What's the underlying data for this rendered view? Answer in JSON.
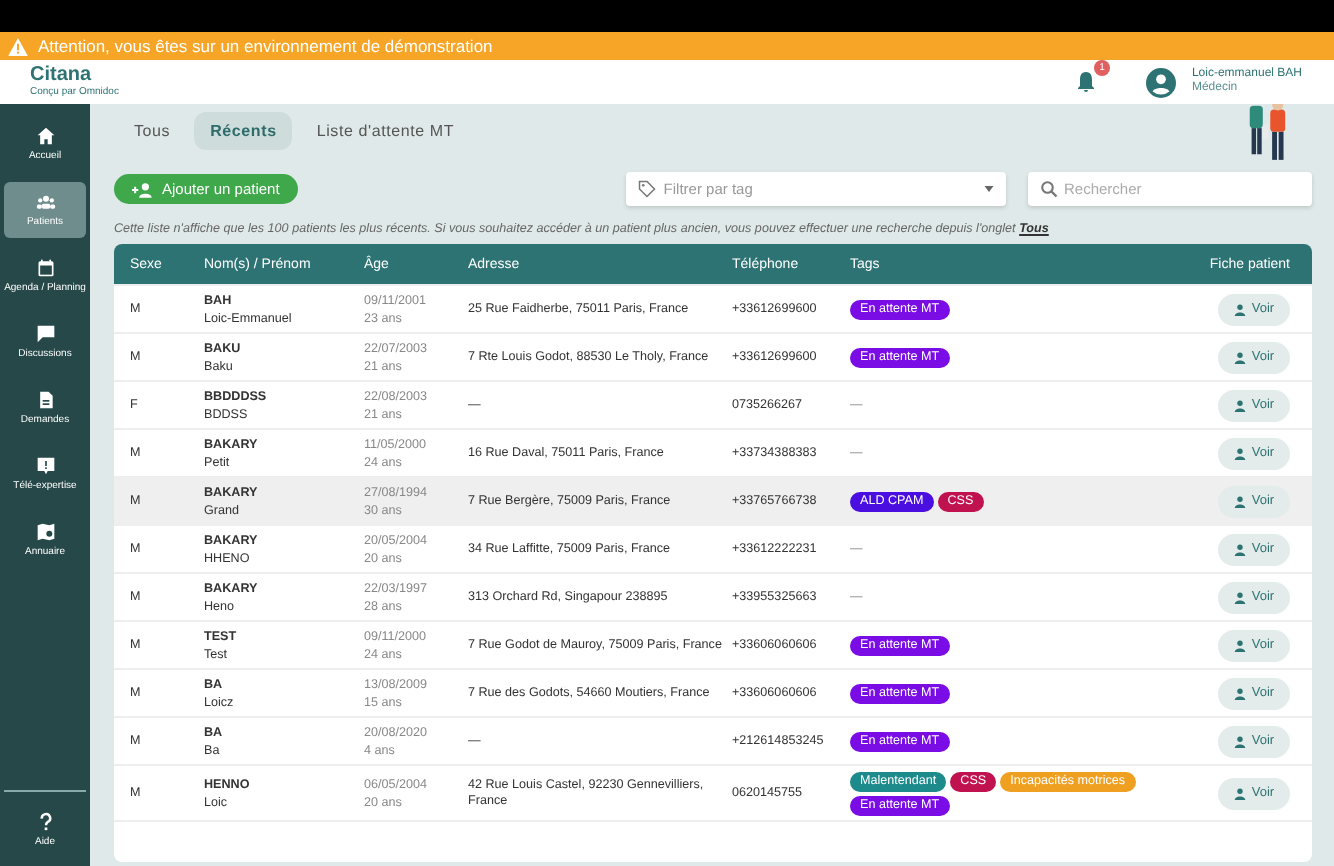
{
  "banner": {
    "text": "Attention, vous êtes sur un environnement de démonstration"
  },
  "header": {
    "logo": "Citana",
    "logo_sub": "Conçu par Omnidoc",
    "notifications": "1",
    "user_name": "Loic-emmanuel BAH",
    "user_role": "Médecin"
  },
  "sidebar": {
    "items": [
      {
        "label": "Accueil",
        "selected": false
      },
      {
        "label": "Patients",
        "selected": true
      },
      {
        "label": "Agenda / Planning",
        "selected": false
      },
      {
        "label": "Discussions",
        "selected": false
      },
      {
        "label": "Demandes",
        "selected": false
      },
      {
        "label": "Télé-expertise",
        "selected": false
      },
      {
        "label": "Annuaire",
        "selected": false
      }
    ],
    "bottom": {
      "label": "Aide"
    }
  },
  "tabs": [
    {
      "label": "Tous",
      "selected": false
    },
    {
      "label": "Récents",
      "selected": true
    },
    {
      "label": "Liste d'attente MT",
      "selected": false
    }
  ],
  "add_button": "Ajouter un patient",
  "tag_filter": {
    "placeholder": "Filtrer par tag"
  },
  "search": {
    "placeholder": "Rechercher"
  },
  "note": {
    "text": "Cette liste n'affiche que les 100 patients les plus récents. Si vous souhaitez accéder à un patient plus ancien, vous pouvez effectuer une recherche depuis l'onglet",
    "link": "Tous"
  },
  "table": {
    "columns": [
      "Sexe",
      "Nom(s) / Prénom",
      "Âge",
      "Adresse",
      "Téléphone",
      "Tags",
      "Fiche patient"
    ],
    "rows": [
      {
        "sex": "M",
        "last": "BAH",
        "first": "Loic-Emmanuel",
        "dob": "09/11/2001",
        "age": "23 ans",
        "address": "25 Rue Faidherbe, 75011 Paris, France",
        "phone": "+33612699600",
        "tags": [
          {
            "label": "En attente MT",
            "color": "#7a0ce6"
          }
        ],
        "action": "Voir",
        "highlighted": false
      },
      {
        "sex": "M",
        "last": "BAKU",
        "first": "Baku",
        "dob": "22/07/2003",
        "age": "21 ans",
        "address": "7 Rte Louis Godot, 88530 Le Tholy, France",
        "phone": "+33612699600",
        "tags": [
          {
            "label": "En attente MT",
            "color": "#7a0ce6"
          }
        ],
        "action": "Voir",
        "highlighted": false
      },
      {
        "sex": "F",
        "last": "BBDDDSS",
        "first": "BDDSS",
        "dob": "22/08/2003",
        "age": "21 ans",
        "address": "—",
        "phone": "0735266267",
        "tags": [],
        "empty_tags": "—",
        "action": "Voir",
        "highlighted": false
      },
      {
        "sex": "M",
        "last": "BAKARY",
        "first": "Petit",
        "dob": "11/05/2000",
        "age": "24 ans",
        "address": "16 Rue Daval, 75011 Paris, France",
        "phone": "+33734388383",
        "tags": [],
        "empty_tags": "—",
        "action": "Voir",
        "highlighted": false
      },
      {
        "sex": "M",
        "last": "BAKARY",
        "first": "Grand",
        "dob": "27/08/1994",
        "age": "30 ans",
        "address": "7 Rue Bergère, 75009 Paris, France",
        "phone": "+33765766738",
        "tags": [
          {
            "label": "ALD CPAM",
            "color": "#4a0fe0"
          },
          {
            "label": "CSS",
            "color": "#c0124f"
          }
        ],
        "action": "Voir",
        "highlighted": true
      },
      {
        "sex": "M",
        "last": "BAKARY",
        "first": "HHENO",
        "dob": "20/05/2004",
        "age": "20 ans",
        "address": "34 Rue Laffitte, 75009 Paris, France",
        "phone": "+33612222231",
        "tags": [],
        "empty_tags": "—",
        "action": "Voir",
        "highlighted": false
      },
      {
        "sex": "M",
        "last": "BAKARY",
        "first": "Heno",
        "dob": "22/03/1997",
        "age": "28 ans",
        "address": "313 Orchard Rd, Singapour 238895",
        "phone": "+33955325663",
        "tags": [],
        "empty_tags": "—",
        "action": "Voir",
        "highlighted": false
      },
      {
        "sex": "M",
        "last": "TEST",
        "first": "Test",
        "dob": "09/11/2000",
        "age": "24 ans",
        "address": "7 Rue Godot de Mauroy, 75009 Paris, France",
        "phone": "+33606060606",
        "tags": [
          {
            "label": "En attente MT",
            "color": "#7a0ce6"
          }
        ],
        "action": "Voir",
        "highlighted": false
      },
      {
        "sex": "M",
        "last": "BA",
        "first": "Loicz",
        "dob": "13/08/2009",
        "age": "15 ans",
        "address": "7 Rue des Godots, 54660 Moutiers, France",
        "phone": "+33606060606",
        "tags": [
          {
            "label": "En attente MT",
            "color": "#7a0ce6"
          }
        ],
        "action": "Voir",
        "highlighted": false
      },
      {
        "sex": "M",
        "last": "BA",
        "first": "Ba",
        "dob": "20/08/2020",
        "age": "4 ans",
        "address": "—",
        "phone": "+212614853245",
        "tags": [
          {
            "label": "En attente MT",
            "color": "#7a0ce6"
          }
        ],
        "action": "Voir",
        "highlighted": false
      },
      {
        "sex": "M",
        "last": "HENNO",
        "first": "Loic",
        "dob": "06/05/2004",
        "age": "20 ans",
        "address": "42 Rue Louis Castel, 92230 Gennevilliers, France",
        "phone": "0620145755",
        "tags": [
          {
            "label": "Malentendant",
            "color": "#1d8a8c"
          },
          {
            "label": "CSS",
            "color": "#c0124f"
          },
          {
            "label": "Incapacités motrices",
            "color": "#f0a020"
          },
          {
            "label": "En attente MT",
            "color": "#7a0ce6"
          }
        ],
        "action": "Voir",
        "highlighted": false
      }
    ]
  }
}
